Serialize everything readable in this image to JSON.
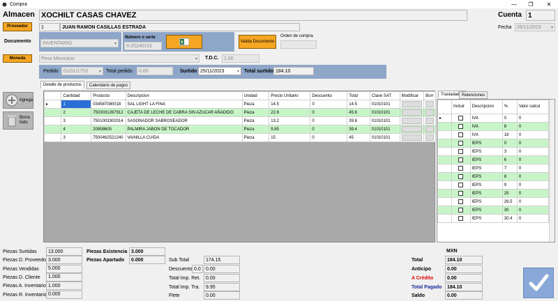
{
  "window": {
    "title": "Compra",
    "minimize": "—",
    "restore": "❐",
    "close": "✕"
  },
  "header": {
    "almacen_label": "Almacen",
    "almacen_value": "XOCHILT CASAS CHAVEZ",
    "cuenta_label": "Cuenta",
    "cuenta_value": "1",
    "proveedor_button": "Proveedor",
    "proveedor_id": "1",
    "proveedor_name": "JUAN RAMON CASILLAS ESTRADA",
    "fecha_label": "Fecha",
    "fecha_value": "25/11/2023",
    "documento_label": "Documento",
    "documento_value": "INVENTARIO",
    "serie_label": "Número o serie",
    "serie_value": "II-20240101",
    "valida_button": "Valida Documento",
    "orden_label": "Orden de compra",
    "moneda_button": "Moneda",
    "moneda_value": "Peso Mexicano",
    "tdc_label": "T.D.C.",
    "tdc_value": "1.00",
    "pedido_label": "Pedido",
    "pedido_value": "01/01/1753",
    "total_pedido_label": "Total pedido",
    "total_pedido_value": "0.00",
    "surtido_label": "Surtido",
    "surtido_value": "25/11/2023",
    "total_surtido_label": "Total surtido",
    "total_surtido_value": "184.10"
  },
  "side_buttons": {
    "agrega": "Agrega",
    "borra": "Borra todo"
  },
  "tabs": {
    "detalle": "Detalle de productos",
    "calendario": "Calendario de pagos"
  },
  "products": {
    "columns": [
      "Cantidad",
      "Producto",
      "Descripcion",
      "Unidad",
      "Precio Unitario",
      "Descuento",
      "Total",
      "Clave SAT",
      "Modificar",
      "Borr"
    ],
    "rows": [
      {
        "cantidad": "1",
        "producto": "034587080018",
        "descripcion": "SAL LIGHT LA FINA",
        "unidad": "Pieza",
        "precio": "14.5",
        "descuento": "0",
        "total": "14.5",
        "clave": "01010101"
      },
      {
        "cantidad": "2",
        "producto": "7503031287912",
        "descripcion": "CAJETA DE LECHE DE CABRA SIN AZUCAR AÑADIDO",
        "unidad": "Pieza",
        "precio": "22.8",
        "descuento": "0",
        "total": "45.6",
        "clave": "01010101"
      },
      {
        "cantidad": "3",
        "producto": "7501003302014",
        "descripcion": "SASONADOR SABROSEADOR",
        "unidad": "Pieza",
        "precio": "13.2",
        "descuento": "0",
        "total": "39.6",
        "clave": "01010101"
      },
      {
        "cantidad": "4",
        "producto": "20858605",
        "descripcion": "PALMIRA JABON DE TOCADOR",
        "unidad": "Pieza",
        "precio": "9.85",
        "descuento": "0",
        "total": "39.4",
        "clave": "01010101"
      },
      {
        "cantidad": "3",
        "producto": "7500462521240",
        "descripcion": "VAINILLA CUIDA",
        "unidad": "Pieza",
        "precio": "15",
        "descuento": "0",
        "total": "45",
        "clave": "01010101"
      }
    ]
  },
  "tax_tabs": {
    "trasladados": "Trasladados",
    "retenciones": "Retenciones"
  },
  "taxes": {
    "columns": [
      "Incluir",
      "Descripcion",
      "%",
      "Valor calcul"
    ],
    "rows": [
      {
        "desc": "IVA",
        "pct": "0",
        "valor": "0"
      },
      {
        "desc": "IVA",
        "pct": "8",
        "valor": "0"
      },
      {
        "desc": "IVA",
        "pct": "16",
        "valor": "0"
      },
      {
        "desc": "IEPS",
        "pct": "0",
        "valor": "0"
      },
      {
        "desc": "IEPS",
        "pct": "3",
        "valor": "0"
      },
      {
        "desc": "IEPS",
        "pct": "6",
        "valor": "0"
      },
      {
        "desc": "IEPS",
        "pct": "7",
        "valor": "0"
      },
      {
        "desc": "IEPS",
        "pct": "8",
        "valor": "0"
      },
      {
        "desc": "IEPS",
        "pct": "9",
        "valor": "0"
      },
      {
        "desc": "IEPS",
        "pct": "25",
        "valor": "0"
      },
      {
        "desc": "IEPS",
        "pct": "26.5",
        "valor": "0"
      },
      {
        "desc": "IEPS",
        "pct": "30",
        "valor": "0"
      },
      {
        "desc": "IEPS",
        "pct": "30.4",
        "valor": "0"
      }
    ]
  },
  "footer": {
    "piezas_surtidas_label": "Piezas Surtidas",
    "piezas_surtidas": "13.000",
    "piezas_d_proveedor_label": "Piezas D. Proveedor",
    "piezas_d_proveedor": "3.000",
    "piezas_vendidas_label": "Piezas Vendidas",
    "piezas_vendidas": "5.000",
    "piezas_d_cliente_label": "Piezas D. Cliente",
    "piezas_d_cliente": "1.000",
    "piezas_a_inventario_label": "Piezas A. Inventario",
    "piezas_a_inventario": "1.000",
    "piezas_r_inventario_label": "Piezas R. Inventario",
    "piezas_r_inventario": "0.000",
    "piezas_existencia_label": "Piezas Existencia",
    "piezas_existencia": "3.000",
    "piezas_apartado_label": "Piezas Apartado",
    "piezas_apartado": "0.000",
    "sub_total_label": "Sub Total",
    "sub_total": "174.15",
    "descuento_label": "Descuento",
    "descuento_pct": "0.0",
    "descuento": "0.00",
    "total_imp_ret_label": "Total Imp. Ret.",
    "total_imp_ret": "0.00",
    "total_imp_tra_label": "Total Imp. Tra.",
    "total_imp_tra": "9.95",
    "flete_label": "Flete",
    "flete": "0.00",
    "mxn_label": "MXN",
    "total_label": "Total",
    "total": "184.10",
    "anticipo_label": "Anticipo",
    "anticipo": "0.00",
    "a_credito_label": "A Crédito",
    "a_credito": "0.00",
    "total_pagado_label": "Total Pagado",
    "total_pagado": "184.10",
    "saldo_label": "Saldo",
    "saldo": "0.00"
  },
  "colors": {
    "orange": "#f5a623",
    "green_row": "#c8f5c8",
    "blue_bar": "#8ea6c8",
    "accept": "#8aa8d8"
  }
}
